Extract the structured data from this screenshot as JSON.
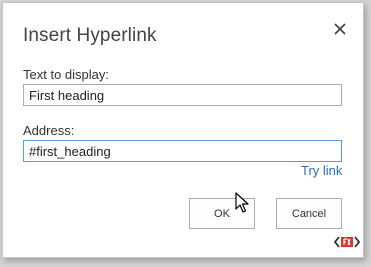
{
  "dialog": {
    "title": "Insert Hyperlink",
    "close_icon": "close-icon"
  },
  "fields": {
    "text_label": "Text to display:",
    "text_value": "First heading",
    "address_label": "Address:",
    "address_value": "#first_heading"
  },
  "try_link_label": "Try link",
  "buttons": {
    "ok_label": "OK",
    "cancel_label": "Cancel"
  },
  "icons": {
    "cursor": "mouse-pointer-icon",
    "extension": "extension-badge-icon"
  },
  "colors": {
    "link": "#2a6ebb",
    "focus_border": "#5b9bd5",
    "badge": "#d9342b"
  }
}
